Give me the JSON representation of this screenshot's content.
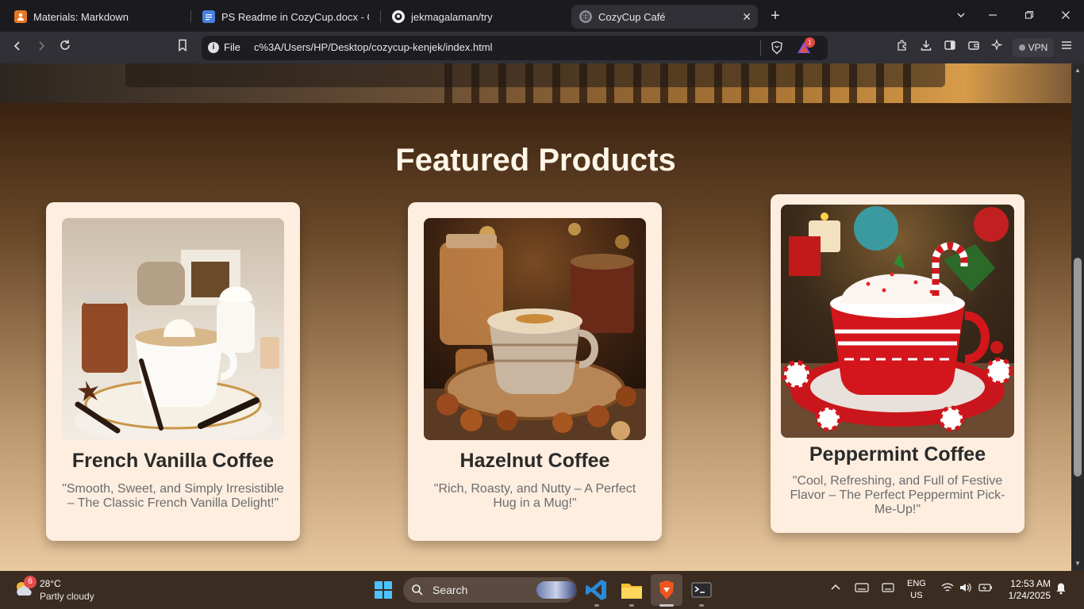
{
  "browser": {
    "tabs": [
      {
        "label": "Materials: Markdown",
        "favicon": "orange-person-icon",
        "active": false
      },
      {
        "label": "PS Readme in CozyCup.docx - Goog",
        "favicon": "docs-icon",
        "active": false
      },
      {
        "label": "jekmagalaman/try",
        "favicon": "github-icon",
        "active": false
      },
      {
        "label": "CozyCup Café",
        "favicon": "globe-icon",
        "active": true
      }
    ],
    "address": {
      "scheme": "File",
      "url": "c%3A/Users/HP/Desktop/cozycup-kenjek/index.html"
    },
    "rewards_count": "1",
    "vpn_label": "VPN"
  },
  "page": {
    "section_title": "Featured Products",
    "products": [
      {
        "name": "French Vanilla Coffee",
        "tagline": "\"Smooth, Sweet, and Simply Irresistible – The Classic French Vanilla Delight!\""
      },
      {
        "name": "Hazelnut Coffee",
        "tagline": "\"Rich, Roasty, and Nutty – A Perfect Hug in a Mug!\""
      },
      {
        "name": "Peppermint Coffee",
        "tagline": "\"Cool, Refreshing, and Full of Festive Flavor – The Perfect Peppermint Pick-Me-Up!\""
      }
    ]
  },
  "taskbar": {
    "weather": {
      "temp": "28°C",
      "condition": "Partly cloudy",
      "badge": "6"
    },
    "search_label": "Search",
    "language": {
      "line1": "ENG",
      "line2": "US"
    },
    "clock": {
      "time": "12:53 AM",
      "date": "1/24/2025"
    }
  },
  "colors": {
    "card_bg": "#fdeee0",
    "title_text": "#fff6e8",
    "product_name": "#2a2a2a",
    "tagline": "#6c6c6c"
  }
}
